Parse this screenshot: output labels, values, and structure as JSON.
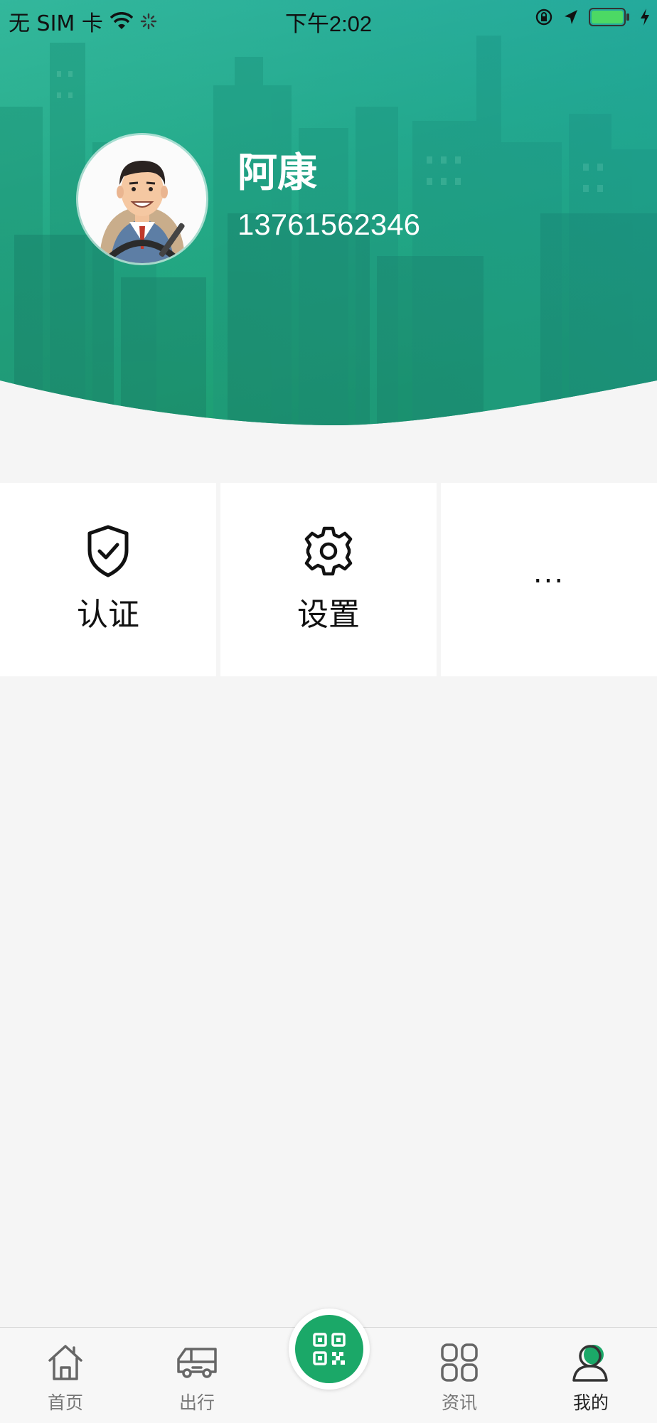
{
  "status_bar": {
    "carrier": "无 SIM 卡",
    "time": "下午2:02"
  },
  "profile": {
    "name": "阿康",
    "phone": "13761562346"
  },
  "grid": [
    {
      "label": "认证",
      "icon": "shield-check-icon"
    },
    {
      "label": "设置",
      "icon": "gear-icon"
    },
    {
      "label": "...",
      "icon": ""
    }
  ],
  "tabs": [
    {
      "label": "首页",
      "icon": "home-icon"
    },
    {
      "label": "出行",
      "icon": "bus-icon"
    },
    {
      "label": "",
      "icon": "qr-code-icon"
    },
    {
      "label": "资讯",
      "icon": "grid-icon"
    },
    {
      "label": "我的",
      "icon": "person-icon",
      "active": true
    }
  ],
  "colors": {
    "accent": "#1ba868",
    "hero_top": "#2bb3a0",
    "hero_bottom": "#1aa36f"
  }
}
